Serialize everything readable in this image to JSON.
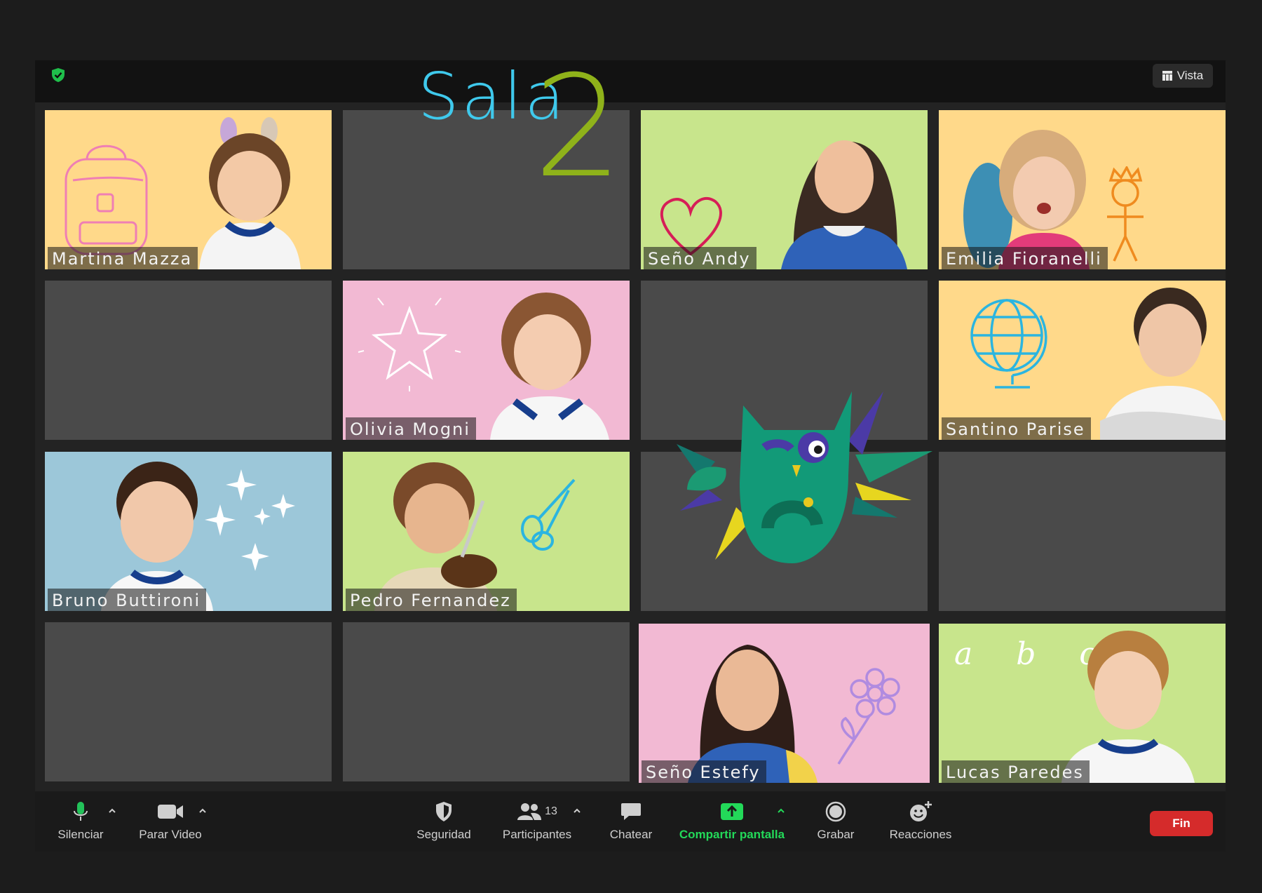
{
  "header": {
    "security_icon": "shield-check-icon",
    "view_button_label": "Vista",
    "view_icon": "grid-view-icon"
  },
  "title": {
    "sala": "Sala",
    "number": "2"
  },
  "colors": {
    "yellow": "#ffd98a",
    "green": "#c8e58c",
    "pink": "#f2b9d3",
    "blue": "#9cc7d9",
    "accent_cyan": "#3fc9ec",
    "accent_green": "#8fb21a",
    "share_green": "#23d959",
    "end_red": "#d52b2b"
  },
  "participants": [
    {
      "name": "Martina Mazza",
      "bg": "yellow",
      "doodle": "backpack"
    },
    {
      "name": "Seño Andy",
      "bg": "green",
      "doodle": "heart"
    },
    {
      "name": "Emilia Fioranelli",
      "bg": "yellow",
      "doodle": "crowned-stick-figure"
    },
    {
      "name": "Olivia Mogni",
      "bg": "pink",
      "doodle": "star"
    },
    {
      "name": "Santino Parise",
      "bg": "yellow",
      "doodle": "globe"
    },
    {
      "name": "Bruno Buttironi",
      "bg": "blue",
      "doodle": "sparkles"
    },
    {
      "name": "Pedro Fernandez",
      "bg": "green",
      "doodle": "scissors"
    },
    {
      "name": "Seño Estefy",
      "bg": "pink",
      "doodle": "flower"
    },
    {
      "name": "Lucas Paredes",
      "bg": "green",
      "doodle": "alphabet",
      "doodle_text": "a b c f"
    }
  ],
  "toolbar": {
    "mute_label": "Silenciar",
    "video_label": "Parar Video",
    "security_label": "Seguridad",
    "participants_label": "Participantes",
    "participants_count": "13",
    "chat_label": "Chatear",
    "share_label": "Compartir pantalla",
    "record_label": "Grabar",
    "reactions_label": "Reacciones",
    "end_label": "Fin"
  }
}
